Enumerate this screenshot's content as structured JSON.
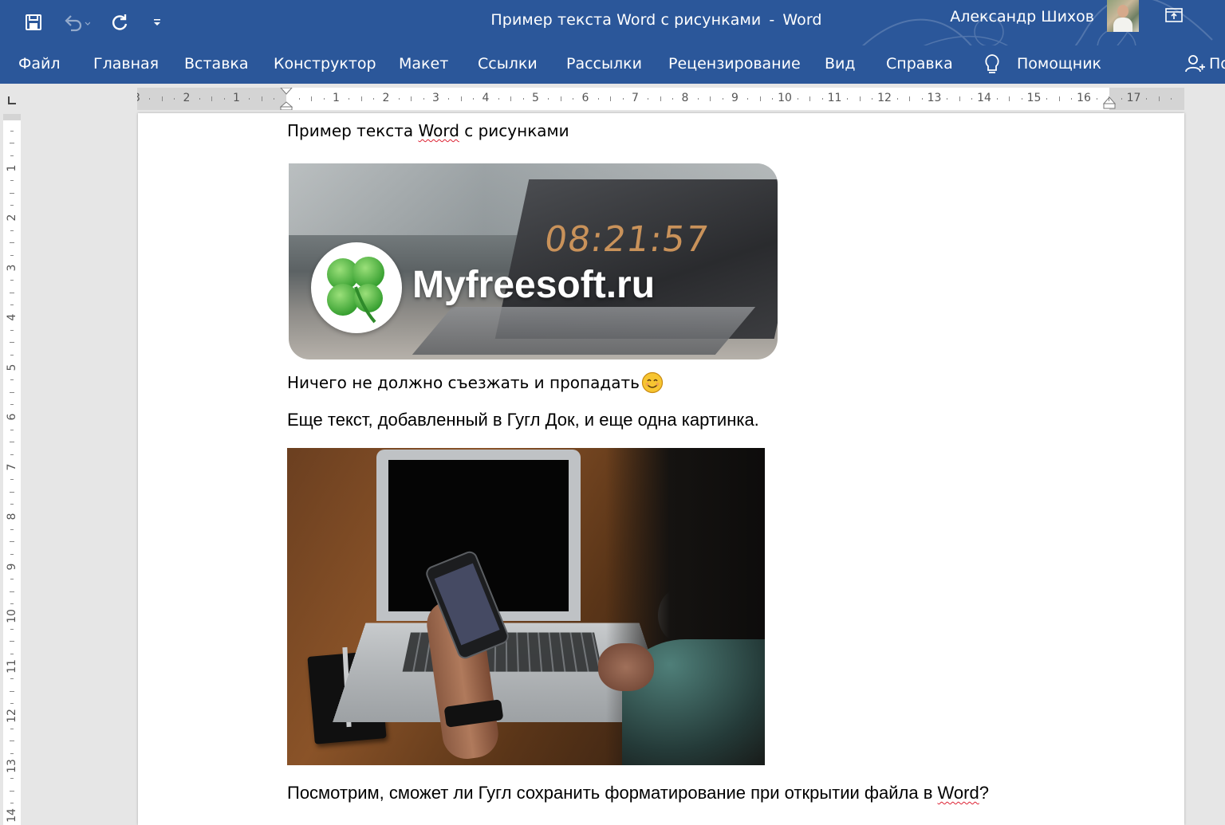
{
  "window": {
    "doc_name": "Пример текста Word с рисунками",
    "separator": "-",
    "app_name": "Word",
    "user_name": "Александр Шихов"
  },
  "colors": {
    "ribbon": "#2b579a",
    "spell_underline": "#dd2233",
    "canvas": "#e6e6e6"
  },
  "quick_access": {
    "icons": [
      "save-icon",
      "undo-icon",
      "redo-icon",
      "customize-qat-icon"
    ]
  },
  "ribbon_tabs": [
    {
      "label": "Файл"
    },
    {
      "label": "Главная"
    },
    {
      "label": "Вставка"
    },
    {
      "label": "Конструктор"
    },
    {
      "label": "Макет"
    },
    {
      "label": "Ссылки"
    },
    {
      "label": "Рассылки"
    },
    {
      "label": "Рецензирование"
    },
    {
      "label": "Вид"
    },
    {
      "label": "Справка"
    }
  ],
  "tell_me": {
    "label": "Помощник",
    "icon": "lightbulb-icon"
  },
  "share": {
    "label": "По",
    "icon": "person-add-icon"
  },
  "horizontal_ruler": {
    "left_labels": [
      "3",
      "2",
      "1"
    ],
    "right_labels": [
      "1",
      "2",
      "3",
      "4",
      "5",
      "6",
      "7",
      "8",
      "9",
      "10",
      "11",
      "12",
      "13",
      "14",
      "15",
      "16",
      "17"
    ]
  },
  "vertical_ruler": {
    "labels": [
      "1",
      "2",
      "3",
      "4",
      "5",
      "6",
      "7",
      "8",
      "9",
      "10",
      "11",
      "12",
      "13",
      "14"
    ]
  },
  "document": {
    "title_line": {
      "before": "Пример текста ",
      "flagged": "Word",
      "after": " с рисунками"
    },
    "image1": {
      "clock_text": "08:21:57",
      "logo_text": "Myfreesoft.ru"
    },
    "note_line": {
      "text": "Ничего не должно съезжать и пропадать",
      "emoji": "smiley-emoji"
    },
    "paragraph1": "Еще текст, добавленный в Гугл Док, и еще одна картинка.",
    "paragraph2": {
      "before": "Посмотрим, сможет ли Гугл сохранить форматирование при открытии файла в ",
      "flagged": "Word",
      "after": "?"
    }
  }
}
